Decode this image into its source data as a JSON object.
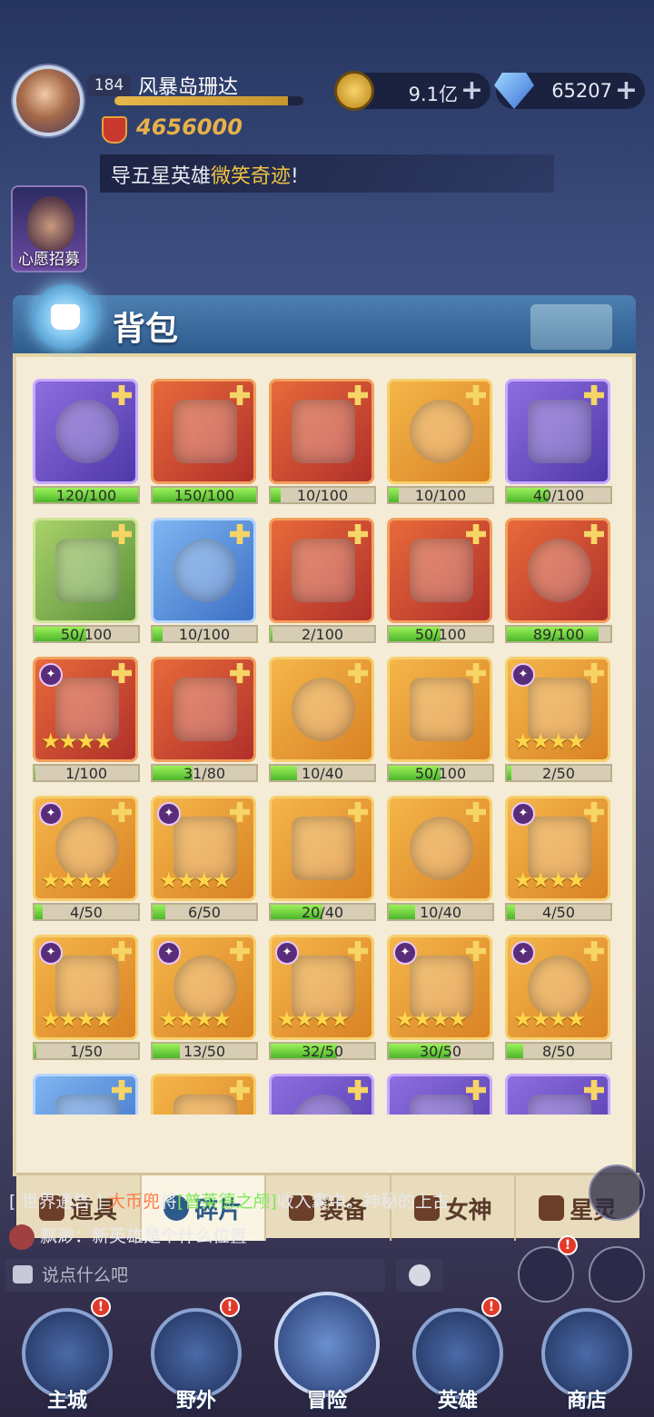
{
  "player": {
    "level": "184",
    "name": "风暴岛珊达",
    "power": "4656000",
    "exp_fraction": 0.92
  },
  "resources": {
    "gold": "9.1亿",
    "gems": "65207"
  },
  "marquee": {
    "prefix": "导五星英雄",
    "highlight": "微笑奇迹",
    "suffix": "!"
  },
  "wish": {
    "label": "心愿招募"
  },
  "panel": {
    "title": "背包"
  },
  "items": [
    {
      "count": "120/100",
      "fill": 1.0,
      "color": "purple",
      "stars": ""
    },
    {
      "count": "150/100",
      "fill": 1.0,
      "color": "red",
      "stars": ""
    },
    {
      "count": "10/100",
      "fill": 0.1,
      "color": "red",
      "stars": ""
    },
    {
      "count": "10/100",
      "fill": 0.1,
      "color": "orange",
      "stars": ""
    },
    {
      "count": "40/100",
      "fill": 0.4,
      "color": "purple",
      "stars": ""
    },
    {
      "count": "50/100",
      "fill": 0.5,
      "color": "green",
      "stars": ""
    },
    {
      "count": "10/100",
      "fill": 0.1,
      "color": "blue",
      "stars": ""
    },
    {
      "count": "2/100",
      "fill": 0.02,
      "color": "red",
      "stars": ""
    },
    {
      "count": "50/100",
      "fill": 0.5,
      "color": "red",
      "stars": ""
    },
    {
      "count": "89/100",
      "fill": 0.89,
      "color": "red",
      "stars": ""
    },
    {
      "count": "1/100",
      "fill": 0.01,
      "color": "red",
      "stars": "★★★★"
    },
    {
      "count": "31/80",
      "fill": 0.39,
      "color": "red",
      "stars": ""
    },
    {
      "count": "10/40",
      "fill": 0.25,
      "color": "orange",
      "stars": ""
    },
    {
      "count": "50/100",
      "fill": 0.5,
      "color": "orange",
      "stars": ""
    },
    {
      "count": "2/50",
      "fill": 0.04,
      "color": "orange",
      "stars": "★★★★"
    },
    {
      "count": "4/50",
      "fill": 0.08,
      "color": "orange",
      "stars": "★★★★"
    },
    {
      "count": "6/50",
      "fill": 0.12,
      "color": "orange",
      "stars": "★★★★"
    },
    {
      "count": "20/40",
      "fill": 0.5,
      "color": "orange",
      "stars": ""
    },
    {
      "count": "10/40",
      "fill": 0.25,
      "color": "orange",
      "stars": ""
    },
    {
      "count": "4/50",
      "fill": 0.08,
      "color": "orange",
      "stars": "★★★★"
    },
    {
      "count": "1/50",
      "fill": 0.02,
      "color": "orange",
      "stars": "★★★★"
    },
    {
      "count": "13/50",
      "fill": 0.26,
      "color": "orange",
      "stars": "★★★★"
    },
    {
      "count": "32/50",
      "fill": 0.64,
      "color": "orange",
      "stars": "★★★★"
    },
    {
      "count": "30/50",
      "fill": 0.6,
      "color": "orange",
      "stars": "★★★★"
    },
    {
      "count": "8/50",
      "fill": 0.16,
      "color": "orange",
      "stars": "★★★★"
    },
    {
      "count": "",
      "fill": 0,
      "color": "blue",
      "stars": ""
    },
    {
      "count": "",
      "fill": 0,
      "color": "orange",
      "stars": ""
    },
    {
      "count": "",
      "fill": 0,
      "color": "purple",
      "stars": ""
    },
    {
      "count": "",
      "fill": 0,
      "color": "purple",
      "stars": ""
    },
    {
      "count": "",
      "fill": 0,
      "color": "purple",
      "stars": ""
    }
  ],
  "tabs": [
    {
      "label": "道具",
      "icon": "tool-icon",
      "active": false
    },
    {
      "label": "碎片",
      "icon": "fragment-icon",
      "active": true
    },
    {
      "label": "装备",
      "icon": "equipment-icon",
      "active": false
    },
    {
      "label": "女神",
      "icon": "goddess-icon",
      "active": false
    },
    {
      "label": "星灵",
      "icon": "star-spirit-icon",
      "active": false
    }
  ],
  "chat": {
    "line1_prefix": "[ 世界通告 ] ",
    "line1_name": "大币兜",
    "line1_mid": "将",
    "line1_item": "[普莱德之颅]",
    "line1_suffix": "收入囊中。神秘的上古",
    "line2_user": "飘渺",
    "line2_text": "：新英雄是个什么位置",
    "input_placeholder": "说点什么吧"
  },
  "nav": [
    {
      "label": "主城",
      "icon": "castle-icon",
      "alert": "!"
    },
    {
      "label": "野外",
      "icon": "field-icon",
      "alert": "!"
    },
    {
      "label": "冒险",
      "icon": "sword-icon",
      "alert": ""
    },
    {
      "label": "英雄",
      "icon": "helmet-icon",
      "alert": "!"
    },
    {
      "label": "商店",
      "icon": "shop-icon",
      "alert": ""
    }
  ],
  "side": {
    "ranking_alert": "!"
  }
}
